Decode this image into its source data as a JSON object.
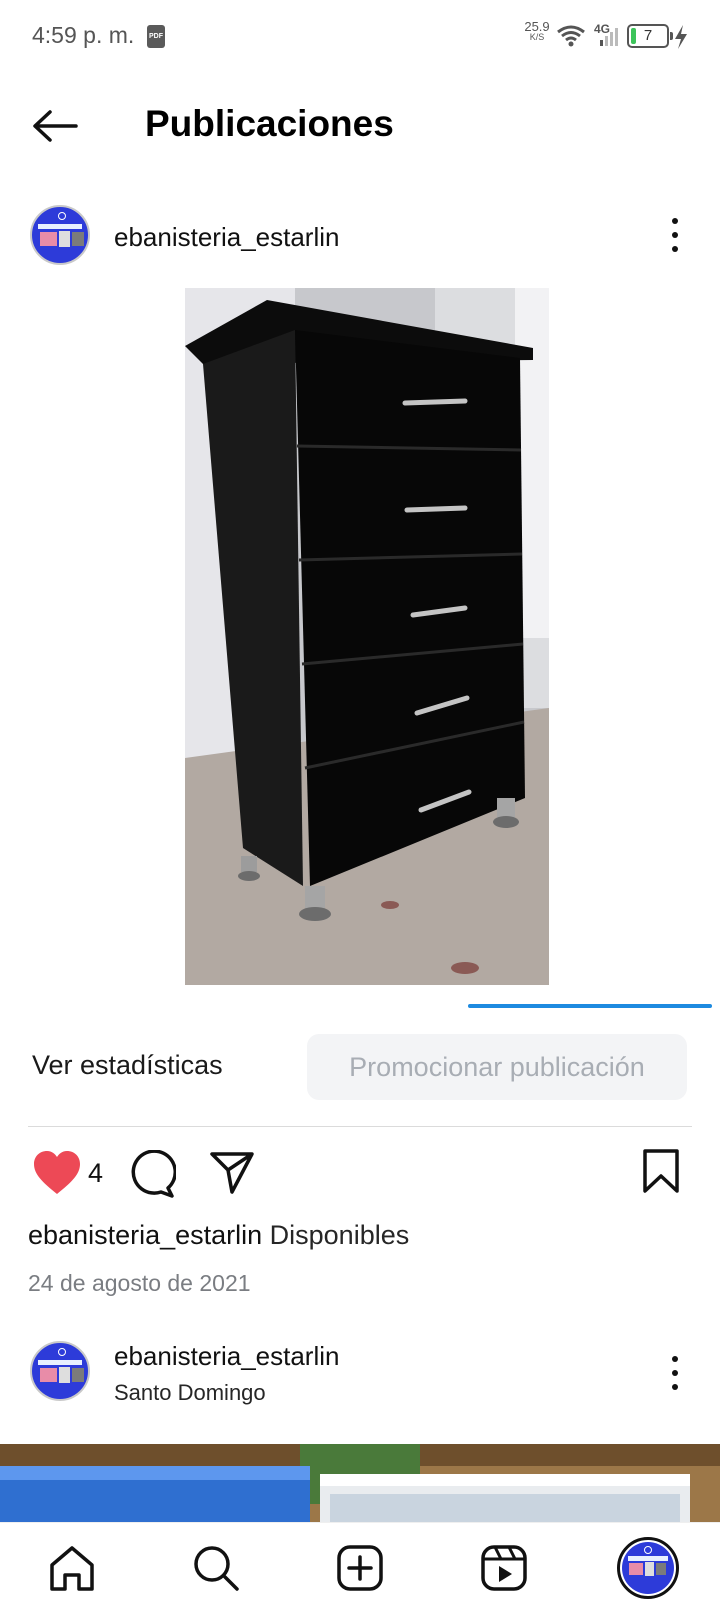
{
  "status_bar": {
    "time": "4:59 p. m.",
    "pdf_badge": "PDF",
    "net_speed_value": "25.9",
    "net_speed_unit": "K/S",
    "network_type": "4G",
    "battery_level": "7",
    "battery_fraction": 0.07,
    "icons": [
      "pdf-icon",
      "wifi-icon",
      "signal-icon",
      "battery-icon",
      "charging-bolt-icon"
    ]
  },
  "header": {
    "title": "Publicaciones",
    "back_icon": "back-arrow-icon"
  },
  "post": {
    "username": "ebanisteria_estarlin",
    "menu_icon": "more-vertical-icon",
    "stats_label": "Ver estadísticas",
    "promote_label": "Promocionar publicación",
    "like_count": "4",
    "caption_text": "Disponibles",
    "date": "24 de agosto de 2021",
    "liked": true,
    "colors": {
      "like": "#ed4956",
      "promote_bg": "#f3f4f6",
      "progress": "#1d8ae0"
    }
  },
  "next_post": {
    "username": "ebanisteria_estarlin",
    "location": "Santo Domingo"
  },
  "bottom_nav": {
    "items": [
      "home-icon",
      "search-icon",
      "create-icon",
      "reels-icon",
      "profile-avatar"
    ]
  }
}
